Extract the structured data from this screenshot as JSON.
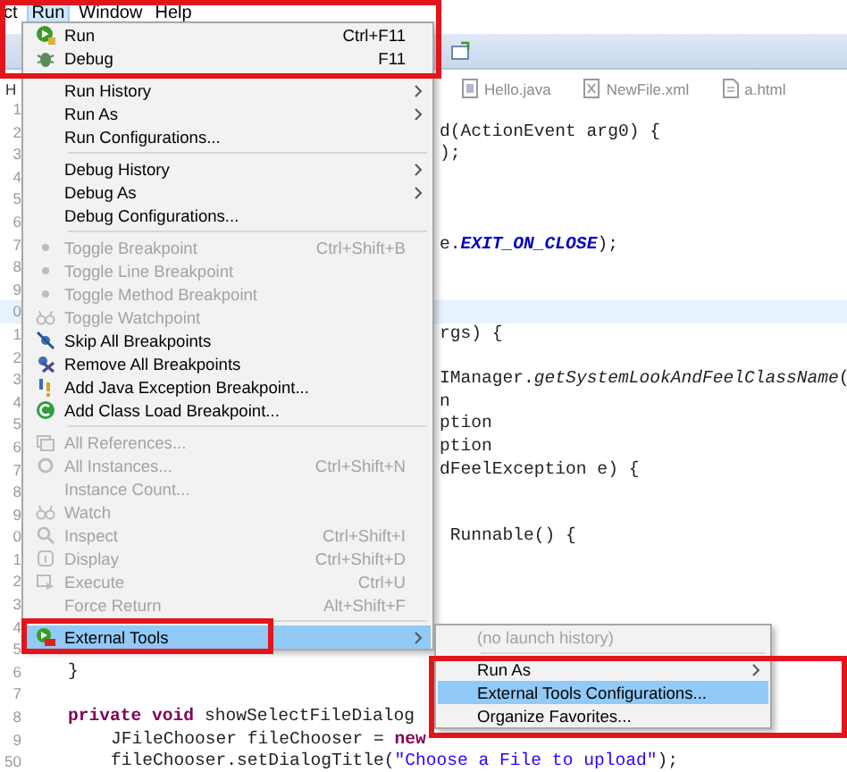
{
  "menubar": [
    {
      "label": "ct",
      "selected": false
    },
    {
      "label": "Run",
      "selected": true
    },
    {
      "label": "Window",
      "selected": false
    },
    {
      "label": "Help",
      "selected": false
    }
  ],
  "tabs": [
    {
      "label": "H"
    },
    {
      "label": "Hello.java"
    },
    {
      "label": "NewFile.xml"
    },
    {
      "label": "a.html"
    }
  ],
  "code_lines": [
    {
      "number": "1"
    },
    {
      "number": "2",
      "kind": "tail",
      "segments": [
        {
          "kind": "plain",
          "text": "d(ActionEvent arg0) {"
        }
      ]
    },
    {
      "number": "3",
      "kind": "tail",
      "segments": [
        {
          "kind": "plain",
          "text": ");"
        }
      ]
    },
    {
      "number": "4"
    },
    {
      "number": "5"
    },
    {
      "number": "6"
    },
    {
      "number": "7",
      "kind": "tail",
      "segments": [
        {
          "kind": "plain",
          "text": "e."
        },
        {
          "kind": "constant",
          "text": "EXIT_ON_CLOSE"
        },
        {
          "kind": "plain",
          "text": ");"
        }
      ]
    },
    {
      "number": "8"
    },
    {
      "number": "9"
    },
    {
      "number": "0",
      "current": true
    },
    {
      "number": "1",
      "kind": "tail",
      "segments": [
        {
          "kind": "plain",
          "text": "rgs) {"
        }
      ]
    },
    {
      "number": "2"
    },
    {
      "number": "3",
      "kind": "tail",
      "segments": [
        {
          "kind": "plain",
          "text": "IManager."
        },
        {
          "kind": "static",
          "text": "getSystemLookAndFeelClassName"
        },
        {
          "kind": "plain",
          "text": "("
        }
      ]
    },
    {
      "number": "4",
      "kind": "tail",
      "segments": [
        {
          "kind": "plain",
          "text": "n"
        }
      ]
    },
    {
      "number": "5",
      "kind": "tail",
      "segments": [
        {
          "kind": "plain",
          "text": "ption"
        }
      ]
    },
    {
      "number": "6",
      "kind": "tail",
      "segments": [
        {
          "kind": "plain",
          "text": "ption"
        }
      ]
    },
    {
      "number": "7",
      "kind": "tail",
      "segments": [
        {
          "kind": "plain",
          "text": "dFeelException e) {"
        }
      ]
    },
    {
      "number": "8"
    },
    {
      "number": "9"
    },
    {
      "number": "0",
      "kind": "tail",
      "segments": [
        {
          "kind": "plain",
          "text": " Runnable() {"
        }
      ]
    },
    {
      "number": "1"
    },
    {
      "number": "2"
    },
    {
      "number": "3"
    },
    {
      "number": "4"
    },
    {
      "number": "5"
    },
    {
      "number": "6",
      "kind": "member",
      "segments": [
        {
          "kind": "plain",
          "text": "}"
        }
      ]
    },
    {
      "number": "7"
    },
    {
      "number": "8",
      "kind": "member",
      "segments": [
        {
          "kind": "keyword",
          "text": "private void"
        },
        {
          "kind": "plain",
          "text": " showSelectFileDialog"
        }
      ]
    },
    {
      "number": "9",
      "kind": "statement",
      "segments": [
        {
          "kind": "plain",
          "text": "JFileChooser fileChooser = "
        },
        {
          "kind": "keyword",
          "text": "new"
        }
      ]
    },
    {
      "number": "50",
      "kind": "statement",
      "segments": [
        {
          "kind": "plain",
          "text": "fileChooser.setDialogTitle("
        },
        {
          "kind": "string",
          "text": "\"Choose a File to upload\""
        },
        {
          "kind": "plain",
          "text": ");"
        }
      ]
    }
  ],
  "run_menu": [
    {
      "kind": "command",
      "label": "Run",
      "shortcut": "Ctrl+F11",
      "submenu": false,
      "disabled": false,
      "selected": false
    },
    {
      "kind": "command",
      "label": "Debug",
      "shortcut": "F11",
      "submenu": false,
      "disabled": false,
      "selected": false
    },
    {
      "kind": "separator"
    },
    {
      "kind": "command",
      "label": "Run History",
      "submenu": true,
      "disabled": false,
      "selected": false
    },
    {
      "kind": "command",
      "label": "Run As",
      "submenu": true,
      "disabled": false,
      "selected": false
    },
    {
      "kind": "command",
      "label": "Run Configurations...",
      "submenu": false,
      "disabled": false,
      "selected": false
    },
    {
      "kind": "separator"
    },
    {
      "kind": "command",
      "label": "Debug History",
      "submenu": true,
      "disabled": false,
      "selected": false
    },
    {
      "kind": "command",
      "label": "Debug As",
      "submenu": true,
      "disabled": false,
      "selected": false
    },
    {
      "kind": "command",
      "label": "Debug Configurations...",
      "submenu": false,
      "disabled": false,
      "selected": false
    },
    {
      "kind": "separator"
    },
    {
      "kind": "command",
      "label": "Toggle Breakpoint",
      "shortcut": "Ctrl+Shift+B",
      "submenu": false,
      "disabled": true,
      "selected": false
    },
    {
      "kind": "command",
      "label": "Toggle Line Breakpoint",
      "submenu": false,
      "disabled": true,
      "selected": false
    },
    {
      "kind": "command",
      "label": "Toggle Method Breakpoint",
      "submenu": false,
      "disabled": true,
      "selected": false
    },
    {
      "kind": "command",
      "label": "Toggle Watchpoint",
      "submenu": false,
      "disabled": true,
      "selected": false
    },
    {
      "kind": "command",
      "label": "Skip All Breakpoints",
      "submenu": false,
      "disabled": false,
      "selected": false
    },
    {
      "kind": "command",
      "label": "Remove All Breakpoints",
      "submenu": false,
      "disabled": false,
      "selected": false
    },
    {
      "kind": "command",
      "label": "Add Java Exception Breakpoint...",
      "submenu": false,
      "disabled": false,
      "selected": false
    },
    {
      "kind": "command",
      "label": "Add Class Load Breakpoint...",
      "submenu": false,
      "disabled": false,
      "selected": false
    },
    {
      "kind": "separator"
    },
    {
      "kind": "command",
      "label": "All References...",
      "submenu": false,
      "disabled": true,
      "selected": false
    },
    {
      "kind": "command",
      "label": "All Instances...",
      "shortcut": "Ctrl+Shift+N",
      "submenu": false,
      "disabled": true,
      "selected": false
    },
    {
      "kind": "command",
      "label": "Instance Count...",
      "submenu": false,
      "disabled": true,
      "selected": false
    },
    {
      "kind": "command",
      "label": "Watch",
      "submenu": false,
      "disabled": true,
      "selected": false
    },
    {
      "kind": "command",
      "label": "Inspect",
      "shortcut": "Ctrl+Shift+I",
      "submenu": false,
      "disabled": true,
      "selected": false
    },
    {
      "kind": "command",
      "label": "Display",
      "shortcut": "Ctrl+Shift+D",
      "submenu": false,
      "disabled": true,
      "selected": false
    },
    {
      "kind": "command",
      "label": "Execute",
      "shortcut": "Ctrl+U",
      "submenu": false,
      "disabled": true,
      "selected": false
    },
    {
      "kind": "command",
      "label": "Force Return",
      "shortcut": "Alt+Shift+F",
      "submenu": false,
      "disabled": true,
      "selected": false
    },
    {
      "kind": "separator"
    },
    {
      "kind": "command",
      "label": "External Tools",
      "submenu": true,
      "disabled": false,
      "selected": true
    }
  ],
  "external_tools_menu": [
    {
      "kind": "command",
      "label": "(no launch history)",
      "submenu": false,
      "disabled": true,
      "selected": false
    },
    {
      "kind": "separator"
    },
    {
      "kind": "command",
      "label": "Run As",
      "submenu": true,
      "disabled": false,
      "selected": false
    },
    {
      "kind": "command",
      "label": "External Tools Configurations...",
      "submenu": false,
      "disabled": false,
      "selected": true
    },
    {
      "kind": "command",
      "label": "Organize Favorites...",
      "submenu": false,
      "disabled": false,
      "selected": false
    }
  ]
}
